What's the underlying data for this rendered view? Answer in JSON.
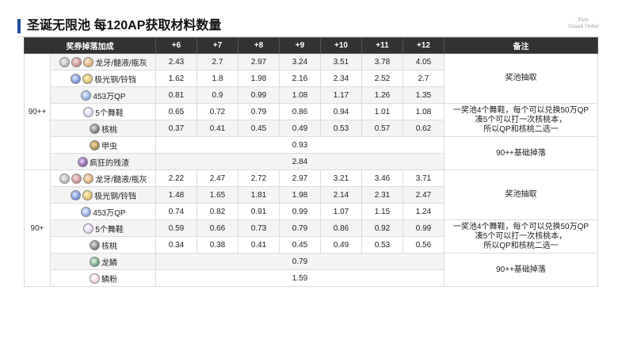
{
  "header": {
    "title": "圣诞无限池 每120AP获取材料数量",
    "logo_line1": "Fate",
    "logo_line2": "Grand Order"
  },
  "columns": {
    "bonus": "奖券掉落加成",
    "levels": [
      "+6",
      "+7",
      "+8",
      "+9",
      "+10",
      "+11",
      "+12"
    ],
    "note": "备注"
  },
  "groups": [
    {
      "tier": "90++",
      "rows": [
        {
          "icons": [
            "fang-icon",
            "ooze-icon",
            "flask-icon"
          ],
          "name": "龙牙/髓液/瓶灰",
          "values": [
            "2.43",
            "2.7",
            "2.97",
            "3.24",
            "3.51",
            "3.78",
            "4.05"
          ]
        },
        {
          "icons": [
            "aurora-steel-icon",
            "bell-icon"
          ],
          "name": "极光钢/铃铛",
          "values": [
            "1.62",
            "1.8",
            "1.98",
            "2.16",
            "2.34",
            "2.52",
            "2.7"
          ]
        },
        {
          "icons": [
            "qp-icon"
          ],
          "name": "453万QP",
          "values": [
            "0.81",
            "0.9",
            "0.99",
            "1.08",
            "1.17",
            "1.26",
            "1.35"
          ]
        },
        {
          "icons": [
            "dancing-shoe-icon"
          ],
          "name": "5个舞鞋",
          "values": [
            "0.65",
            "0.72",
            "0.79",
            "0.86",
            "0.94",
            "1.01",
            "1.08"
          ]
        },
        {
          "icons": [
            "walnut-icon"
          ],
          "name": "核桃",
          "values": [
            "0.37",
            "0.41",
            "0.45",
            "0.49",
            "0.53",
            "0.57",
            "0.62"
          ]
        },
        {
          "icons": [
            "beetle-icon"
          ],
          "name": "甲虫",
          "base": "0.93"
        },
        {
          "icons": [
            "madness-residue-icon"
          ],
          "name": "疯狂的残渣",
          "base": "2.84"
        }
      ],
      "notes": {
        "pool": "奖池抽取",
        "exchange_line1": "一奖池4个舞鞋，每个可以兑换50万QP",
        "exchange_line2": "凑5个可以打一次核桃本，",
        "exchange_line3": "所以QP和核桃二选一",
        "base": "90++基础掉落"
      }
    },
    {
      "tier": "90+",
      "rows": [
        {
          "icons": [
            "fang-icon",
            "ooze-icon",
            "flask-icon"
          ],
          "name": "龙牙/髓液/瓶灰",
          "values": [
            "2.22",
            "2.47",
            "2.72",
            "2.97",
            "3.21",
            "3.46",
            "3.71"
          ]
        },
        {
          "icons": [
            "aurora-steel-icon",
            "bell-icon"
          ],
          "name": "极光钢/铃铛",
          "values": [
            "1.48",
            "1.65",
            "1.81",
            "1.98",
            "2.14",
            "2.31",
            "2.47"
          ]
        },
        {
          "icons": [
            "qp-icon"
          ],
          "name": "453万QP",
          "values": [
            "0.74",
            "0.82",
            "0.91",
            "0.99",
            "1.07",
            "1.15",
            "1.24"
          ]
        },
        {
          "icons": [
            "dancing-shoe-icon"
          ],
          "name": "5个舞鞋",
          "values": [
            "0.59",
            "0.66",
            "0.73",
            "0.79",
            "0.86",
            "0.92",
            "0.99"
          ]
        },
        {
          "icons": [
            "walnut-icon"
          ],
          "name": "核桃",
          "values": [
            "0.34",
            "0.38",
            "0.41",
            "0.45",
            "0.49",
            "0.53",
            "0.56"
          ]
        },
        {
          "icons": [
            "dragon-scale-icon"
          ],
          "name": "龙鳞",
          "base": "0.79"
        },
        {
          "icons": [
            "scale-powder-icon"
          ],
          "name": "鳞粉",
          "base": "1.59"
        }
      ],
      "notes": {
        "pool": "奖池抽取",
        "exchange_line1": "一奖池4个舞鞋，每个可以兑换50万QP",
        "exchange_line2": "凑5个可以打一次核桃本，",
        "exchange_line3": "所以QP和核桃二选一",
        "base": "90++基础掉落"
      }
    }
  ]
}
